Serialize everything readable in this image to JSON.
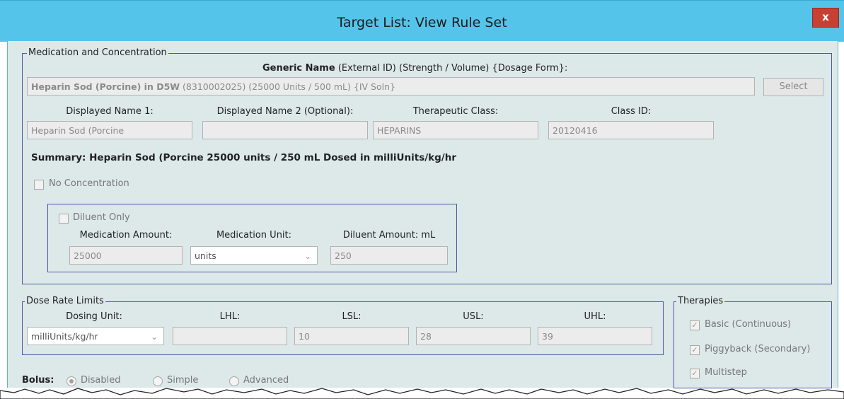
{
  "window": {
    "title": "Target List:  View Rule Set",
    "close_label": "x"
  },
  "medication": {
    "legend": "Medication and Concentration",
    "generic_header_bold": "Generic Name",
    "generic_header_rest": " (External ID)  (Strength / Volume)  {Dosage Form}:",
    "generic_value_bold": "Heparin Sod (Porcine) in D5W",
    "generic_value_rest": " (8310002025) (25000 Units / 500 mL) {IV Soln}",
    "select_label": "Select",
    "displayed_name1_label": "Displayed Name 1:",
    "displayed_name1_value": "Heparin Sod (Porcine",
    "displayed_name2_label": "Displayed Name 2 (Optional):",
    "displayed_name2_value": "",
    "therapeutic_class_label": "Therapeutic Class:",
    "therapeutic_class_value": "HEPARINS",
    "class_id_label": "Class ID:",
    "class_id_value": "20120416",
    "summary": "Summary: Heparin Sod (Porcine  25000 units / 250 mL Dosed in milliUnits/kg/hr",
    "no_concentration_label": "No Concentration",
    "diluent_only_label": "Diluent Only",
    "med_amount_label": "Medication Amount:",
    "med_amount_value": "25000",
    "med_unit_label": "Medication Unit:",
    "med_unit_value": "units",
    "diluent_amount_label": "Diluent Amount: mL",
    "diluent_amount_value": "250"
  },
  "dose_limits": {
    "legend": "Dose Rate Limits",
    "dosing_unit_label": "Dosing Unit:",
    "dosing_unit_value": "milliUnits/kg/hr",
    "lhl_label": "LHL:",
    "lhl_value": "",
    "lsl_label": "LSL:",
    "lsl_value": "10",
    "usl_label": "USL:",
    "usl_value": "28",
    "uhl_label": "UHL:",
    "uhl_value": "39"
  },
  "therapies": {
    "legend": "Therapies",
    "basic_label": "Basic (Continuous)",
    "piggyback_label": "Piggyback (Secondary)",
    "multistep_label": "Multistep"
  },
  "bolus": {
    "label": "Bolus:",
    "disabled_label": "Disabled",
    "simple_label": "Simple",
    "advanced_label": "Advanced",
    "selected": "Disabled"
  },
  "icons": {
    "checkmark": "✓",
    "dropdown": "chevron-down-icon"
  }
}
